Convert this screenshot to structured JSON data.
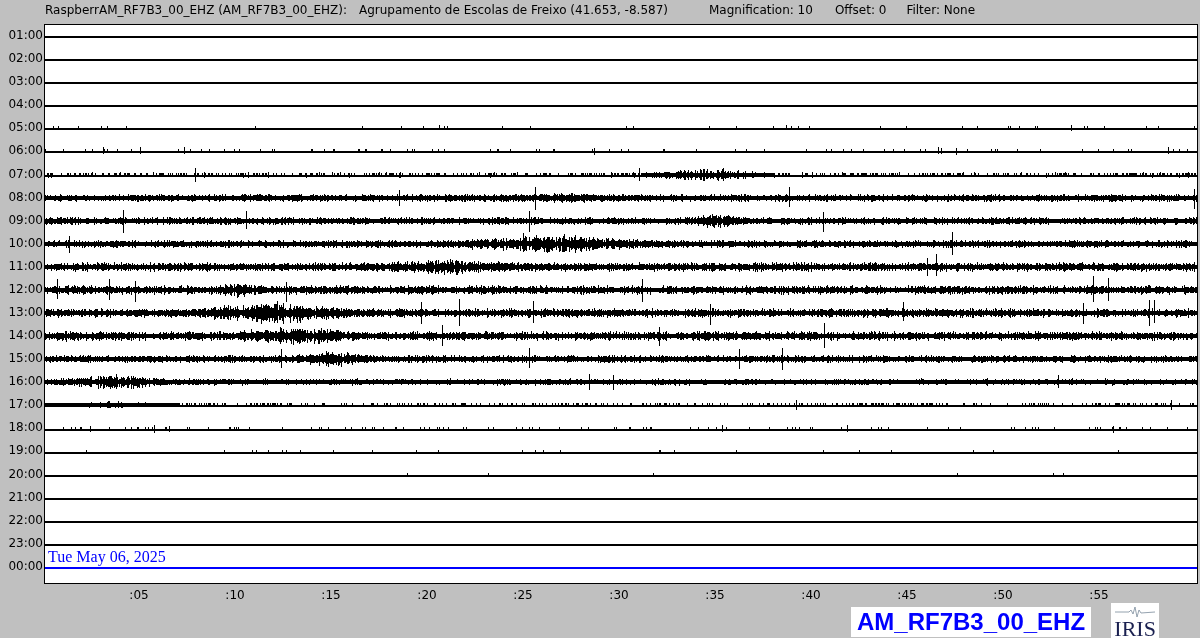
{
  "header": {
    "station": "RaspberrAM_RF7B3_00_EHZ (AM_RF7B3_00_EHZ):",
    "location": "Agrupamento de Escolas de Freixo (41.653, -8.587)",
    "magnification": "Magnification: 10",
    "offset": "Offset: 0",
    "filter": "Filter: None"
  },
  "rows": [
    {
      "label": "01:00",
      "color": "#000000"
    },
    {
      "label": "02:00",
      "color": "#000000"
    },
    {
      "label": "03:00",
      "color": "#000000"
    },
    {
      "label": "04:00",
      "color": "#000000"
    },
    {
      "label": "05:00",
      "color": "#000000"
    },
    {
      "label": "06:00",
      "color": "#000000"
    },
    {
      "label": "07:00",
      "color": "#000000"
    },
    {
      "label": "08:00",
      "color": "#000000"
    },
    {
      "label": "09:00",
      "color": "#000000"
    },
    {
      "label": "10:00",
      "color": "#000000"
    },
    {
      "label": "11:00",
      "color": "#000000"
    },
    {
      "label": "12:00",
      "color": "#000000"
    },
    {
      "label": "13:00",
      "color": "#000000"
    },
    {
      "label": "14:00",
      "color": "#000000"
    },
    {
      "label": "15:00",
      "color": "#000000"
    },
    {
      "label": "16:00",
      "color": "#000000"
    },
    {
      "label": "17:00",
      "color": "#000000"
    },
    {
      "label": "18:00",
      "color": "#000000"
    },
    {
      "label": "19:00",
      "color": "#000000"
    },
    {
      "label": "20:00",
      "color": "#000000"
    },
    {
      "label": "21:00",
      "color": "#000000"
    },
    {
      "label": "22:00",
      "color": "#000000"
    },
    {
      "label": "23:00",
      "color": "#000000"
    },
    {
      "label": "00:00",
      "color": "#0000ff"
    }
  ],
  "date": "Tue May 06, 2025",
  "x_ticks": [
    ":05",
    ":10",
    ":15",
    ":20",
    ":25",
    ":30",
    ":35",
    ":40",
    ":45",
    ":50",
    ":55"
  ],
  "channel": "AM_RF7B3_00_EHZ",
  "logo": "IRIS"
}
